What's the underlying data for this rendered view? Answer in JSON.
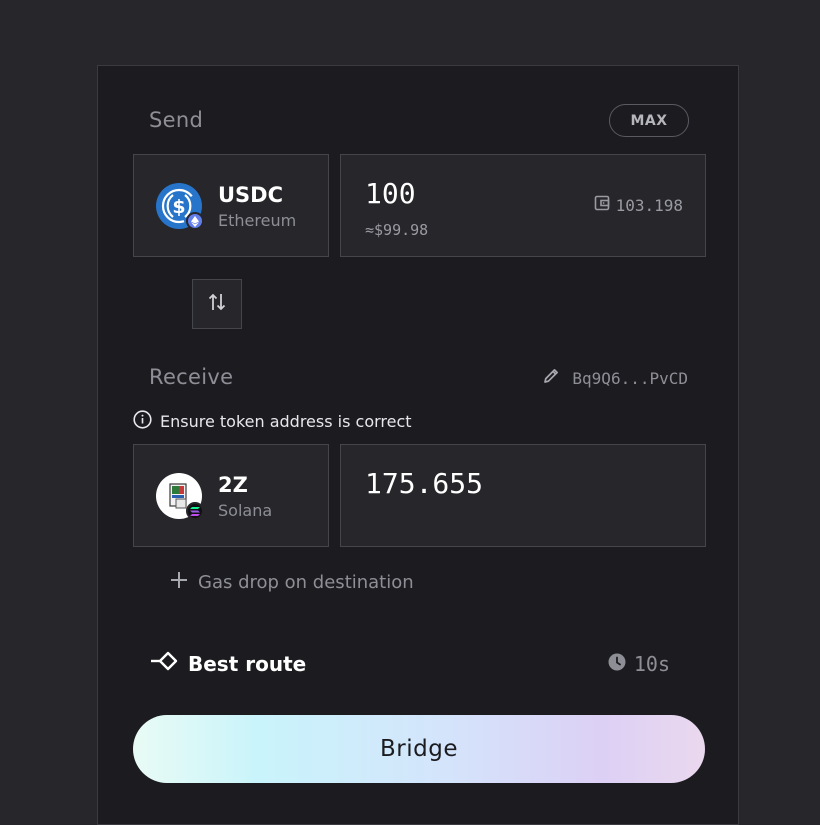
{
  "send": {
    "label": "Send",
    "max_label": "MAX",
    "token": {
      "symbol": "USDC",
      "chain": "Ethereum",
      "icon": "usdc-icon",
      "badge_icon": "ethereum-icon"
    },
    "amount": "100",
    "amount_usd": "≈$99.98",
    "balance": "103.198"
  },
  "receive": {
    "label": "Receive",
    "address": "Bq9Q6...PvCD",
    "warning": "Ensure token address is correct",
    "token": {
      "symbol": "2Z",
      "chain": "Solana",
      "icon": "2z-token-icon",
      "badge_icon": "solana-icon"
    },
    "amount": "175.655"
  },
  "gas_drop": {
    "label": "Gas drop on destination"
  },
  "route": {
    "label": "Best route",
    "time": "10s"
  },
  "bridge": {
    "label": "Bridge"
  },
  "colors": {
    "background": "#26262b",
    "panel": "#1c1c20",
    "box": "#26262b",
    "usdc_blue": "#2775ca",
    "muted_text": "#8e8e96"
  }
}
